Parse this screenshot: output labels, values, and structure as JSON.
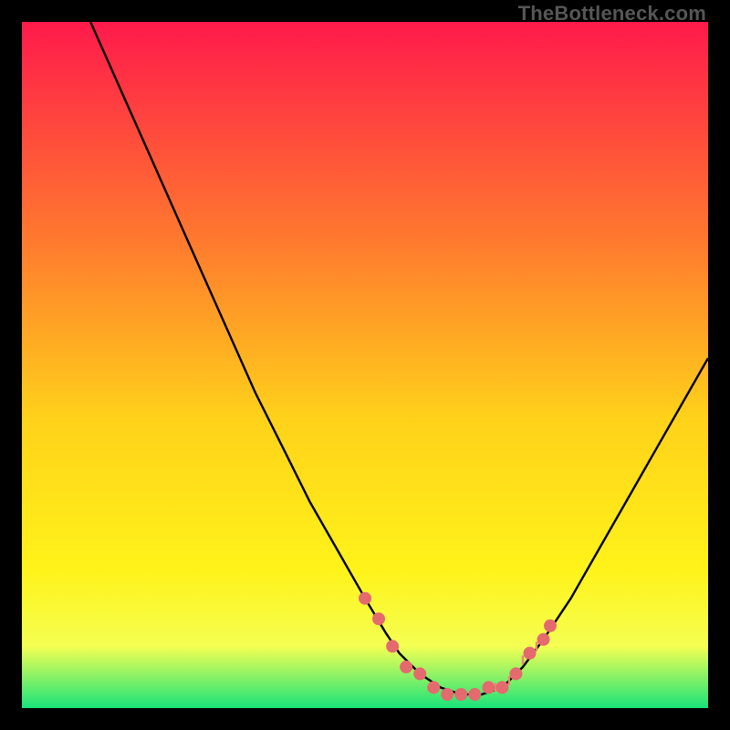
{
  "watermark": "TheBottleneck.com",
  "colors": {
    "gradient_top": "#ff1a4b",
    "gradient_mid1": "#ff7a2e",
    "gradient_mid2": "#ffd21a",
    "gradient_mid3": "#fff31a",
    "gradient_mid4": "#f4ff52",
    "gradient_bottom": "#19e37a",
    "curve": "#000000",
    "marker": "#e46a6e",
    "tick": "#e78b72"
  },
  "chart_data": {
    "type": "line",
    "title": "",
    "xlabel": "",
    "ylabel": "",
    "xlim": [
      0,
      100
    ],
    "ylim": [
      0,
      100
    ],
    "grid": false,
    "legend": "none",
    "series": [
      {
        "name": "bottleneck-curve",
        "x": [
          10,
          14,
          18,
          22,
          26,
          30,
          34,
          38,
          42,
          46,
          50,
          53,
          55,
          58,
          61,
          64,
          67,
          70,
          73,
          76,
          80,
          84,
          88,
          92,
          96,
          100
        ],
        "y": [
          100,
          91,
          82,
          73,
          64,
          55,
          46,
          38,
          30,
          23,
          16,
          11,
          8,
          5,
          3,
          2,
          2,
          3,
          6,
          10,
          16,
          23,
          30,
          37,
          44,
          51
        ]
      }
    ],
    "markers": {
      "name": "highlight-points",
      "x": [
        50,
        52,
        54,
        56,
        58,
        60,
        62,
        64,
        66,
        68,
        70,
        72,
        74,
        76,
        77
      ],
      "y": [
        16,
        13,
        9,
        6,
        5,
        3,
        2,
        2,
        2,
        3,
        3,
        5,
        8,
        10,
        12
      ]
    },
    "ticks": {
      "name": "baseline-ticks",
      "x": [
        69,
        70,
        71,
        72,
        73,
        74,
        75,
        76,
        77
      ],
      "y": [
        3,
        3,
        4,
        5,
        7,
        8,
        9,
        10,
        12
      ]
    }
  }
}
